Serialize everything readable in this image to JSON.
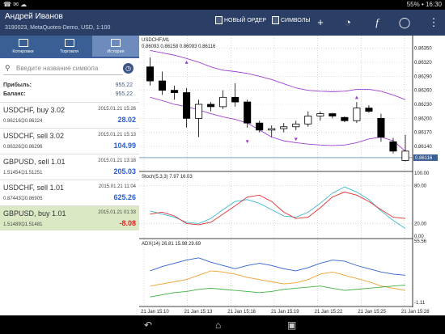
{
  "status_bar": {
    "left_icons": "☎ ✉ ☁",
    "right": "55% • 16:30",
    "battery": "55%",
    "time": "16:30"
  },
  "account": {
    "name": "Андрей Иванов",
    "info": "3190023, MetaQuotes-Demo, USD, 1:100"
  },
  "toolbar": {
    "new_order": "НОВЫЙ ОРДЕР",
    "symbols": "СИМВОЛЫ"
  },
  "tabs": [
    "Котировки",
    "Торговля",
    "История"
  ],
  "search": {
    "placeholder": "Введите название символа"
  },
  "balance": {
    "profit_label": "Прибыль:",
    "profit": "955.22",
    "balance_label": "Баланс:",
    "balance": "955.22"
  },
  "orders": [
    {
      "symbol": "USDCHF, buy 3.02",
      "time": "2015.01.21 15:26",
      "prices": "0.86216➀0.86224",
      "profit": "28.02",
      "color": "#2a5bd0"
    },
    {
      "symbol": "USDCHF, sell 3.02",
      "time": "2015.01.21 15:13",
      "prices": "0.86326➀0.86296",
      "profit": "104.99",
      "color": "#2a5bd0"
    },
    {
      "symbol": "GBPUSD, sell 1.01",
      "time": "2015.01.21 13:18",
      "prices": "1.51454➀1.51251",
      "profit": "205.03",
      "color": "#2a5bd0"
    },
    {
      "symbol": "USDCHF, sell 1.01",
      "time": "2015.01.21 11:04",
      "prices": "0.87443➀0.86905",
      "profit": "625.26",
      "color": "#2a5bd0"
    },
    {
      "symbol": "GBPUSD, buy 1.01",
      "time": "2015.01.21 01:33",
      "prices": "1.51489➀1.51481",
      "profit": "-8.08",
      "color": "#e02020"
    }
  ],
  "chart": {
    "header": "USDCHF,M1",
    "ohlc": "0.86093 0.86158 0.86093 0.86116",
    "price_ticks": [
      "0.86350",
      "0.86320",
      "0.86290",
      "0.86260",
      "0.86230",
      "0.86200",
      "0.86170",
      "0.86140"
    ],
    "price_tick_values": [
      0.8635,
      0.8632,
      0.8629,
      0.8626,
      0.8623,
      0.862,
      0.8617,
      0.8614
    ],
    "price_range": [
      0.8609,
      0.8637
    ],
    "current_price": "0.86116",
    "current_price_value": 0.86116,
    "stoch_label": "Stoch(5,3,3) 7.97 16.03",
    "stoch_ticks": [
      "100.00",
      "80.00",
      "20.00",
      "0.00"
    ],
    "stoch_tick_values": [
      100,
      80,
      20,
      0
    ],
    "adx_label": "ADX(14) 26.81 15.98 29.69",
    "adx_ticks": [
      "55.56",
      "-1.11"
    ],
    "adx_tick_values": [
      55.56,
      -1.11
    ],
    "time_labels": [
      "21 Jan 15:10",
      "21 Jan 15:13",
      "21 Jan 15:16",
      "21 Jan 15:19",
      "21 Jan 15:22",
      "21 Jan 15:25",
      "21 Jan 15:28"
    ],
    "colors": {
      "bull": "#ffffff",
      "bear": "#000000",
      "envelope": "#a040d0",
      "stoch_main": "#e03030",
      "stoch_signal": "#40b8d0",
      "adx": "#3060d0",
      "plus_di": "#f0a030",
      "minus_di": "#40b040"
    },
    "candles": [
      {
        "o": 0.8631,
        "h": 0.8633,
        "l": 0.8627,
        "c": 0.8628
      },
      {
        "o": 0.8628,
        "h": 0.863,
        "l": 0.8625,
        "c": 0.8626
      },
      {
        "o": 0.8626,
        "h": 0.8627,
        "l": 0.8624,
        "c": 0.86255
      },
      {
        "o": 0.86255,
        "h": 0.86265,
        "l": 0.8618,
        "c": 0.862
      },
      {
        "o": 0.862,
        "h": 0.8624,
        "l": 0.8616,
        "c": 0.8623
      },
      {
        "o": 0.8623,
        "h": 0.86235,
        "l": 0.86215,
        "c": 0.86225
      },
      {
        "o": 0.86225,
        "h": 0.8626,
        "l": 0.8622,
        "c": 0.86245
      },
      {
        "o": 0.86245,
        "h": 0.86275,
        "l": 0.86225,
        "c": 0.86235
      },
      {
        "o": 0.86235,
        "h": 0.8624,
        "l": 0.8618,
        "c": 0.8619
      },
      {
        "o": 0.8619,
        "h": 0.86195,
        "l": 0.8617,
        "c": 0.86175
      },
      {
        "o": 0.86175,
        "h": 0.86185,
        "l": 0.8616,
        "c": 0.86178
      },
      {
        "o": 0.86178,
        "h": 0.8619,
        "l": 0.8617,
        "c": 0.86182
      },
      {
        "o": 0.86182,
        "h": 0.86195,
        "l": 0.86175,
        "c": 0.86188
      },
      {
        "o": 0.86188,
        "h": 0.86215,
        "l": 0.86182,
        "c": 0.86205
      },
      {
        "o": 0.86205,
        "h": 0.86215,
        "l": 0.86195,
        "c": 0.8621
      },
      {
        "o": 0.8621,
        "h": 0.86212,
        "l": 0.862,
        "c": 0.86205
      },
      {
        "o": 0.86202,
        "h": 0.86204,
        "l": 0.86192,
        "c": 0.86195
      },
      {
        "o": 0.86195,
        "h": 0.86235,
        "l": 0.8619,
        "c": 0.86222
      },
      {
        "o": 0.86222,
        "h": 0.86228,
        "l": 0.86212,
        "c": 0.86215
      },
      {
        "o": 0.862,
        "h": 0.8621,
        "l": 0.8615,
        "c": 0.8616
      },
      {
        "o": 0.8615,
        "h": 0.86158,
        "l": 0.86125,
        "c": 0.8613
      },
      {
        "o": 0.8611,
        "h": 0.86165,
        "l": 0.86108,
        "c": 0.8613
      }
    ],
    "arrows_up": [
      {
        "i": 3,
        "p": 0.8632
      },
      {
        "i": 17,
        "p": 0.86245
      }
    ],
    "arrows_down": [
      {
        "i": 8,
        "p": 0.8615
      },
      {
        "i": 12,
        "p": 0.86155
      }
    ],
    "env_upper": [
      0.86345,
      0.8634,
      0.86335,
      0.86328,
      0.8632,
      0.8631,
      0.86303,
      0.863,
      0.86296,
      0.8629,
      0.86283,
      0.86274,
      0.86265,
      0.8626,
      0.86258,
      0.86257,
      0.86258,
      0.86262,
      0.86262,
      0.86258,
      0.8625,
      0.8624
    ],
    "env_lower": [
      0.86245,
      0.86238,
      0.8623,
      0.86225,
      0.86218,
      0.8621,
      0.86203,
      0.86198,
      0.8619,
      0.86175,
      0.8616,
      0.86152,
      0.86148,
      0.86145,
      0.86143,
      0.86142,
      0.86143,
      0.86148,
      0.86156,
      0.8616,
      0.86152,
      0.8613
    ],
    "stoch_main": [
      35,
      38,
      32,
      20,
      18,
      22,
      35,
      48,
      62,
      65,
      55,
      38,
      28,
      30,
      45,
      62,
      70,
      65,
      55,
      42,
      30,
      28
    ],
    "stoch_signal": [
      40,
      35,
      30,
      22,
      20,
      28,
      42,
      55,
      58,
      52,
      42,
      32,
      30,
      38,
      52,
      68,
      78,
      70,
      58,
      40,
      25,
      12
    ],
    "adx": [
      28,
      32,
      35,
      38,
      40,
      36,
      33,
      30,
      33,
      35,
      33,
      30,
      28,
      31,
      35,
      38,
      37,
      33,
      30,
      27,
      25,
      24
    ],
    "plus_di": [
      14,
      16,
      18,
      20,
      24,
      28,
      27,
      25,
      22,
      20,
      18,
      16,
      17,
      20,
      25,
      27,
      24,
      21,
      18,
      14,
      12,
      10
    ],
    "minus_di": [
      4,
      6,
      8,
      9,
      11,
      12,
      11,
      10,
      9,
      8,
      9,
      11,
      12,
      13,
      14,
      12,
      10,
      11,
      12,
      13,
      14,
      15
    ]
  }
}
